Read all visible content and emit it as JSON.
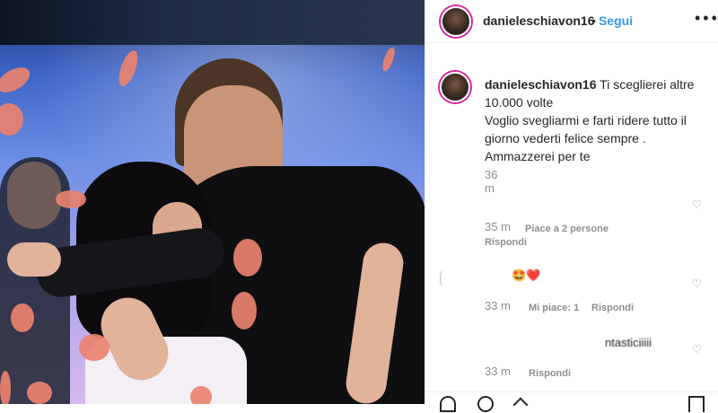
{
  "post": {
    "username": "danieleschiavon16",
    "separator": "•",
    "follow_label": "Segui",
    "more_icon": "more-horizontal-icon"
  },
  "caption": {
    "username": "danieleschiavon16",
    "line1": "Ti sceglierei altre",
    "line2": "10.000 volte",
    "line3": "Voglio svegliarmi e farti ridere tutto il",
    "line4": "giorno vederti felice sempre .",
    "line5": "Ammazzerei per te",
    "time": "36 m"
  },
  "comments": [
    {
      "time": "35 m",
      "likes": "Piace a 2 persone",
      "reply": "Rispondi"
    },
    {
      "text": "🤩❤️",
      "time": "33 m",
      "likes": "Mi piace: 1",
      "reply": "Rispondi"
    },
    {
      "text": "ntasticiiiii",
      "time": "33 m",
      "reply": "Rispondi"
    }
  ],
  "colors": {
    "accent": "#3897f0",
    "ring": "#d6249f",
    "muted": "#8e8e8e"
  }
}
